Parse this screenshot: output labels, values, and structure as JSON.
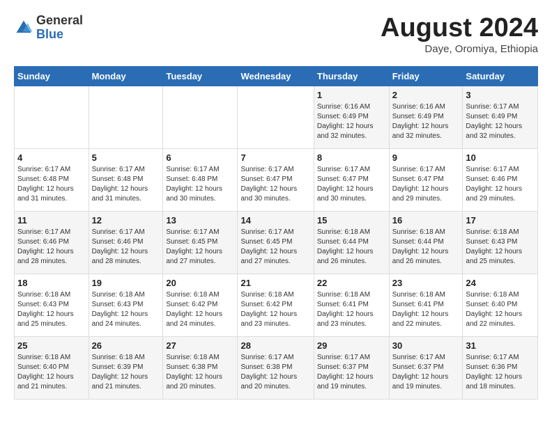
{
  "header": {
    "logo_general": "General",
    "logo_blue": "Blue",
    "month_year": "August 2024",
    "location": "Daye, Oromiya, Ethiopia"
  },
  "days_of_week": [
    "Sunday",
    "Monday",
    "Tuesday",
    "Wednesday",
    "Thursday",
    "Friday",
    "Saturday"
  ],
  "weeks": [
    [
      {
        "day": "",
        "info": ""
      },
      {
        "day": "",
        "info": ""
      },
      {
        "day": "",
        "info": ""
      },
      {
        "day": "",
        "info": ""
      },
      {
        "day": "1",
        "info": "Sunrise: 6:16 AM\nSunset: 6:49 PM\nDaylight: 12 hours\nand 32 minutes."
      },
      {
        "day": "2",
        "info": "Sunrise: 6:16 AM\nSunset: 6:49 PM\nDaylight: 12 hours\nand 32 minutes."
      },
      {
        "day": "3",
        "info": "Sunrise: 6:17 AM\nSunset: 6:49 PM\nDaylight: 12 hours\nand 32 minutes."
      }
    ],
    [
      {
        "day": "4",
        "info": "Sunrise: 6:17 AM\nSunset: 6:48 PM\nDaylight: 12 hours\nand 31 minutes."
      },
      {
        "day": "5",
        "info": "Sunrise: 6:17 AM\nSunset: 6:48 PM\nDaylight: 12 hours\nand 31 minutes."
      },
      {
        "day": "6",
        "info": "Sunrise: 6:17 AM\nSunset: 6:48 PM\nDaylight: 12 hours\nand 30 minutes."
      },
      {
        "day": "7",
        "info": "Sunrise: 6:17 AM\nSunset: 6:47 PM\nDaylight: 12 hours\nand 30 minutes."
      },
      {
        "day": "8",
        "info": "Sunrise: 6:17 AM\nSunset: 6:47 PM\nDaylight: 12 hours\nand 30 minutes."
      },
      {
        "day": "9",
        "info": "Sunrise: 6:17 AM\nSunset: 6:47 PM\nDaylight: 12 hours\nand 29 minutes."
      },
      {
        "day": "10",
        "info": "Sunrise: 6:17 AM\nSunset: 6:46 PM\nDaylight: 12 hours\nand 29 minutes."
      }
    ],
    [
      {
        "day": "11",
        "info": "Sunrise: 6:17 AM\nSunset: 6:46 PM\nDaylight: 12 hours\nand 28 minutes."
      },
      {
        "day": "12",
        "info": "Sunrise: 6:17 AM\nSunset: 6:46 PM\nDaylight: 12 hours\nand 28 minutes."
      },
      {
        "day": "13",
        "info": "Sunrise: 6:17 AM\nSunset: 6:45 PM\nDaylight: 12 hours\nand 27 minutes."
      },
      {
        "day": "14",
        "info": "Sunrise: 6:17 AM\nSunset: 6:45 PM\nDaylight: 12 hours\nand 27 minutes."
      },
      {
        "day": "15",
        "info": "Sunrise: 6:18 AM\nSunset: 6:44 PM\nDaylight: 12 hours\nand 26 minutes."
      },
      {
        "day": "16",
        "info": "Sunrise: 6:18 AM\nSunset: 6:44 PM\nDaylight: 12 hours\nand 26 minutes."
      },
      {
        "day": "17",
        "info": "Sunrise: 6:18 AM\nSunset: 6:43 PM\nDaylight: 12 hours\nand 25 minutes."
      }
    ],
    [
      {
        "day": "18",
        "info": "Sunrise: 6:18 AM\nSunset: 6:43 PM\nDaylight: 12 hours\nand 25 minutes."
      },
      {
        "day": "19",
        "info": "Sunrise: 6:18 AM\nSunset: 6:43 PM\nDaylight: 12 hours\nand 24 minutes."
      },
      {
        "day": "20",
        "info": "Sunrise: 6:18 AM\nSunset: 6:42 PM\nDaylight: 12 hours\nand 24 minutes."
      },
      {
        "day": "21",
        "info": "Sunrise: 6:18 AM\nSunset: 6:42 PM\nDaylight: 12 hours\nand 23 minutes."
      },
      {
        "day": "22",
        "info": "Sunrise: 6:18 AM\nSunset: 6:41 PM\nDaylight: 12 hours\nand 23 minutes."
      },
      {
        "day": "23",
        "info": "Sunrise: 6:18 AM\nSunset: 6:41 PM\nDaylight: 12 hours\nand 22 minutes."
      },
      {
        "day": "24",
        "info": "Sunrise: 6:18 AM\nSunset: 6:40 PM\nDaylight: 12 hours\nand 22 minutes."
      }
    ],
    [
      {
        "day": "25",
        "info": "Sunrise: 6:18 AM\nSunset: 6:40 PM\nDaylight: 12 hours\nand 21 minutes."
      },
      {
        "day": "26",
        "info": "Sunrise: 6:18 AM\nSunset: 6:39 PM\nDaylight: 12 hours\nand 21 minutes."
      },
      {
        "day": "27",
        "info": "Sunrise: 6:18 AM\nSunset: 6:38 PM\nDaylight: 12 hours\nand 20 minutes."
      },
      {
        "day": "28",
        "info": "Sunrise: 6:17 AM\nSunset: 6:38 PM\nDaylight: 12 hours\nand 20 minutes."
      },
      {
        "day": "29",
        "info": "Sunrise: 6:17 AM\nSunset: 6:37 PM\nDaylight: 12 hours\nand 19 minutes."
      },
      {
        "day": "30",
        "info": "Sunrise: 6:17 AM\nSunset: 6:37 PM\nDaylight: 12 hours\nand 19 minutes."
      },
      {
        "day": "31",
        "info": "Sunrise: 6:17 AM\nSunset: 6:36 PM\nDaylight: 12 hours\nand 18 minutes."
      }
    ]
  ]
}
